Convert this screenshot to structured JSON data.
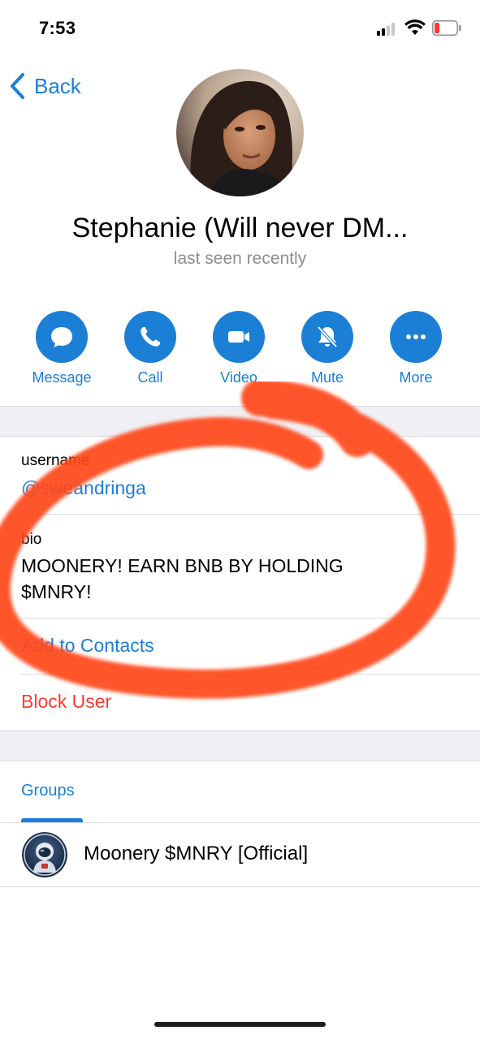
{
  "status_bar": {
    "time": "7:53",
    "icons": [
      "signal-icon",
      "wifi-icon",
      "battery-icon"
    ],
    "battery_color": "#FF3B30"
  },
  "nav": {
    "back_label": "Back",
    "back_icon": "chevron-left-icon"
  },
  "profile": {
    "name": "Stephanie (Will never DM...",
    "status": "last seen recently"
  },
  "actions": [
    {
      "label": "Message",
      "icon": "message-bubble-icon"
    },
    {
      "label": "Call",
      "icon": "phone-icon"
    },
    {
      "label": "Video",
      "icon": "video-camera-icon"
    },
    {
      "label": "Mute",
      "icon": "bell-slash-icon"
    },
    {
      "label": "More",
      "icon": "ellipsis-icon"
    }
  ],
  "info": {
    "username_caption": "username",
    "username_value": "@sweandringa",
    "bio_caption": "bio",
    "bio_value_line1": "MOONERY! EARN BNB BY HOLDING",
    "bio_value_line2": "$MNRY!",
    "add_contact_label": "Add to Contacts",
    "block_label": "Block User"
  },
  "tabs": {
    "groups_label": "Groups"
  },
  "groups": [
    {
      "name": "Moonery $MNRY [Official]",
      "icon": "astronaut-avatar-icon"
    }
  ],
  "colors": {
    "accent": "#1B7FD6",
    "destructive": "#FF3B30",
    "annotation": "#FF4A1F",
    "secondary_text": "#8E8E93",
    "section_bg": "#EFEFF4"
  }
}
